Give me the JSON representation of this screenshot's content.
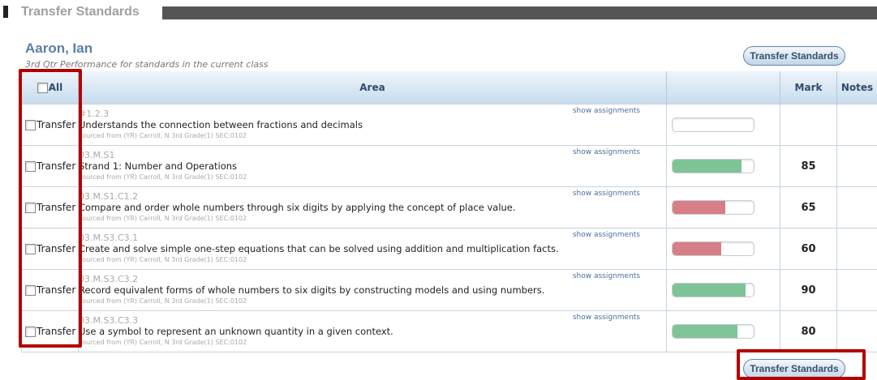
{
  "section": {
    "title": "Transfer Standards"
  },
  "student": {
    "name": "Aaron, Ian",
    "subtitle": "3rd Qtr Performance for standards in the current class"
  },
  "buttons": {
    "transfer_top": "Transfer Standards",
    "transfer_bottom": "Transfer Standards"
  },
  "table": {
    "headers": {
      "all": "All",
      "area": "Area",
      "mark": "Mark",
      "notes": "Notes"
    },
    "rows": [
      {
        "transfer_label": "Transfer",
        "code": "#1.2.3",
        "description": "Understands the connection between fractions and decimals",
        "source": "sourced from (YR) Carroll, N 3rd Grade(1) SEC:0102",
        "show": "show assignments",
        "mark": "",
        "progress": 0,
        "status": "none"
      },
      {
        "transfer_label": "Transfer",
        "code": "03.M.S1",
        "description": "Strand 1: Number and Operations",
        "source": "sourced from (YR) Carroll, N 3rd Grade(1) SEC:0102",
        "show": "show assignments",
        "mark": "85",
        "progress": 85,
        "status": "pass"
      },
      {
        "transfer_label": "Transfer",
        "code": "03.M.S1.C1.2",
        "description": "Compare and order whole numbers through six digits by applying the concept of place value.",
        "source": "sourced from (YR) Carroll, N 3rd Grade(1) SEC:0102",
        "show": "show assignments",
        "mark": "65",
        "progress": 65,
        "status": "fail"
      },
      {
        "transfer_label": "Transfer",
        "code": "03.M.S3.C3.1",
        "description": "Create and solve simple one-step equations that can be solved using addition and multiplication facts.",
        "source": "sourced from (YR) Carroll, N 3rd Grade(1) SEC:0102",
        "show": "show assignments",
        "mark": "60",
        "progress": 60,
        "status": "fail"
      },
      {
        "transfer_label": "Transfer",
        "code": "03.M.S3.C3.2",
        "description": "Record equivalent forms of whole numbers to six digits by constructing models and using numbers.",
        "source": "sourced from (YR) Carroll, N 3rd Grade(1) SEC:0102",
        "show": "show assignments",
        "mark": "90",
        "progress": 90,
        "status": "pass"
      },
      {
        "transfer_label": "Transfer",
        "code": "03.M.S3.C3.3",
        "description": "Use a symbol to represent an unknown quantity in a given context.",
        "source": "sourced from (YR) Carroll, N 3rd Grade(1) SEC:0102",
        "show": "show assignments",
        "mark": "80",
        "progress": 80,
        "status": "pass"
      }
    ]
  },
  "colors": {
    "pass": "#7fc497",
    "fail": "#d77f86",
    "highlight": "#b30000",
    "link": "#4a6fa0"
  }
}
